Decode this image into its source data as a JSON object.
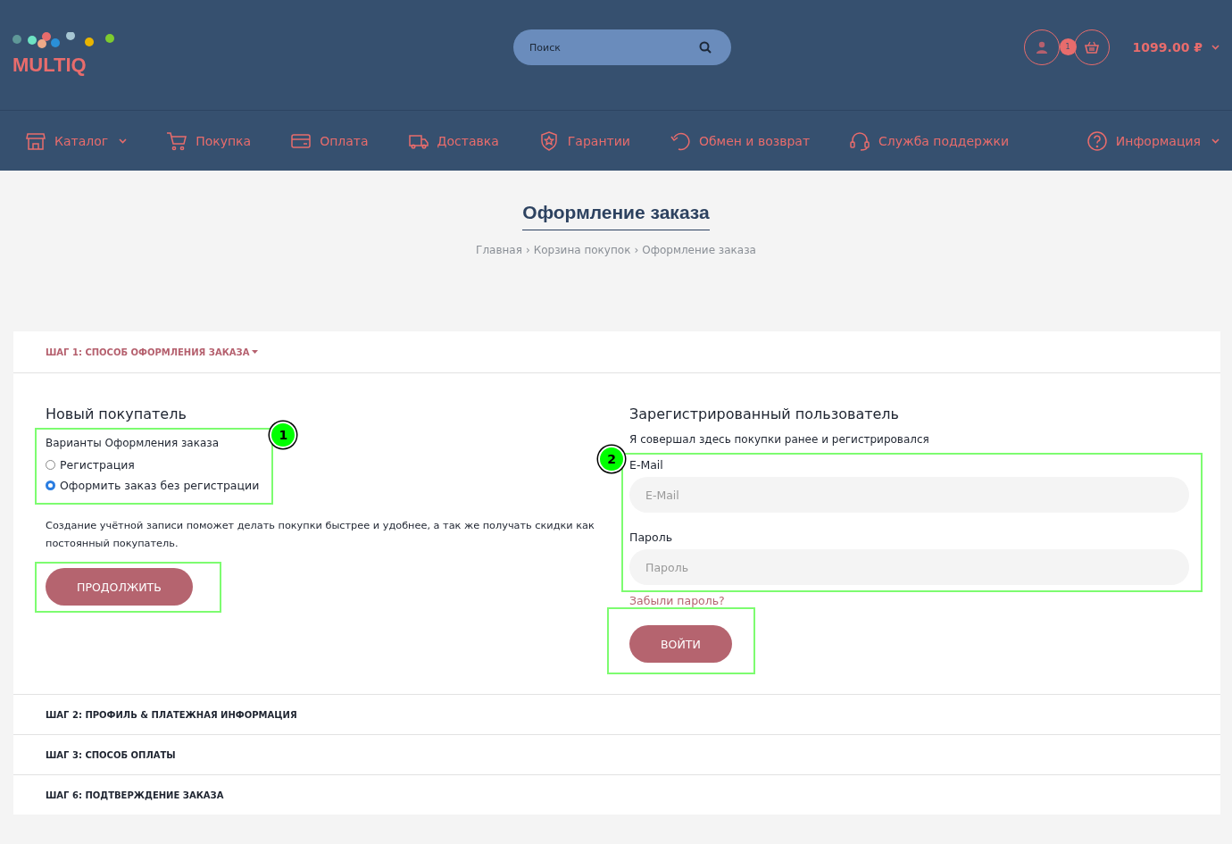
{
  "header": {
    "logo": "MULTIQ",
    "search": {
      "placeholder": "Поиск"
    },
    "cart": {
      "count": "1",
      "total": "1099.00 ₽"
    }
  },
  "nav": [
    {
      "label": "Каталог",
      "dropdown": true
    },
    {
      "label": "Покупка",
      "dropdown": false
    },
    {
      "label": "Оплата",
      "dropdown": false
    },
    {
      "label": "Доставка",
      "dropdown": false
    },
    {
      "label": "Гарантии",
      "dropdown": false
    },
    {
      "label": "Обмен и возврат",
      "dropdown": false
    },
    {
      "label": "Служба поддержки",
      "dropdown": false
    },
    {
      "label": "Информация",
      "dropdown": true
    }
  ],
  "page": {
    "title": "Оформление заказа",
    "breadcrumbs": [
      "Главная",
      "Корзина покупок",
      "Оформление заказа"
    ],
    "breadcrumb_separator": "›"
  },
  "steps": [
    {
      "title": "ШАГ 1: СПОСОБ ОФОРМЛЕНИЯ ЗАКАЗА",
      "expanded": true
    },
    {
      "title": "ШАГ 2: ПРОФИЛЬ & ПЛАТЕЖНАЯ ИНФОРМАЦИЯ",
      "expanded": false
    },
    {
      "title": "ШАГ 3: СПОСОБ ОПЛАТЫ",
      "expanded": false
    },
    {
      "title": "ШАГ 6: ПОДТВЕРЖДЕНИЕ ЗАКАЗА",
      "expanded": false
    }
  ],
  "new_customer": {
    "heading": "Новый покупатель",
    "options_label": "Варианты Оформления заказа",
    "options": [
      {
        "label": "Регистрация",
        "selected": false
      },
      {
        "label": "Оформить заказ без регистрации",
        "selected": true
      }
    ],
    "note": "Создание учётной записи поможет делать покупки быстрее и удобнее, а так же получать скидки как постоянный покупатель.",
    "button": "ПРОДОЛЖИТЬ"
  },
  "registered": {
    "heading": "Зарегистрированный пользователь",
    "note": "Я совершал здесь покупки ранее и регистрировался",
    "fields": [
      {
        "label": "E-Mail",
        "placeholder": "E-Mail"
      },
      {
        "label": "Пароль",
        "placeholder": "Пароль"
      }
    ],
    "forgot": "Забыли пароль?",
    "button": "ВОЙТИ"
  },
  "annotations": [
    {
      "label": "1"
    },
    {
      "label": "2"
    }
  ]
}
